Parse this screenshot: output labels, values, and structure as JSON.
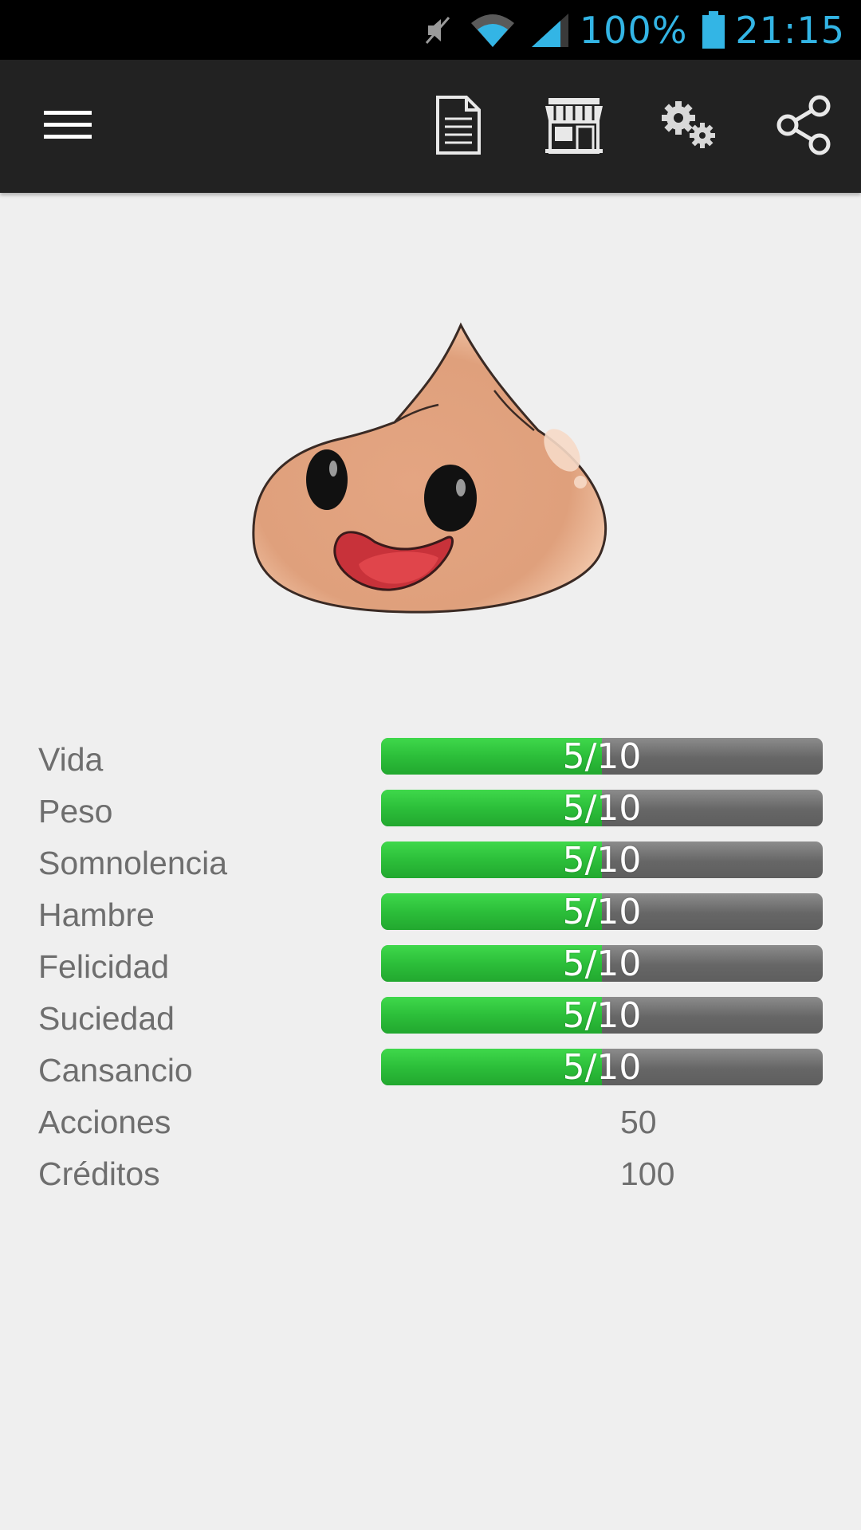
{
  "status_bar": {
    "battery": "100%",
    "time": "21:15",
    "icons": [
      "mute-icon",
      "wifi-icon",
      "signal-icon",
      "battery-icon"
    ],
    "color": "#33b5e5"
  },
  "action_bar": {
    "icons": [
      "menu-icon",
      "document-icon",
      "store-icon",
      "settings-icon",
      "share-icon"
    ],
    "background": "#222222"
  },
  "stats": [
    {
      "label": "Vida",
      "text": "5/10",
      "value": 5,
      "max": 10
    },
    {
      "label": "Peso",
      "text": "5/10",
      "value": 5,
      "max": 10
    },
    {
      "label": "Somnolencia",
      "text": "5/10",
      "value": 5,
      "max": 10
    },
    {
      "label": "Hambre",
      "text": "5/10",
      "value": 5,
      "max": 10
    },
    {
      "label": "Felicidad",
      "text": "5/10",
      "value": 5,
      "max": 10
    },
    {
      "label": "Suciedad",
      "text": "5/10",
      "value": 5,
      "max": 10
    },
    {
      "label": "Cansancio",
      "text": "5/10",
      "value": 5,
      "max": 10
    }
  ],
  "counters": [
    {
      "label": "Acciones",
      "value": "50"
    },
    {
      "label": "Créditos",
      "value": "100"
    }
  ],
  "colors": {
    "bar_fill": "#2cbf3a",
    "bar_track": "#666666",
    "label_text": "#6e6e6e",
    "background": "#efefef"
  }
}
